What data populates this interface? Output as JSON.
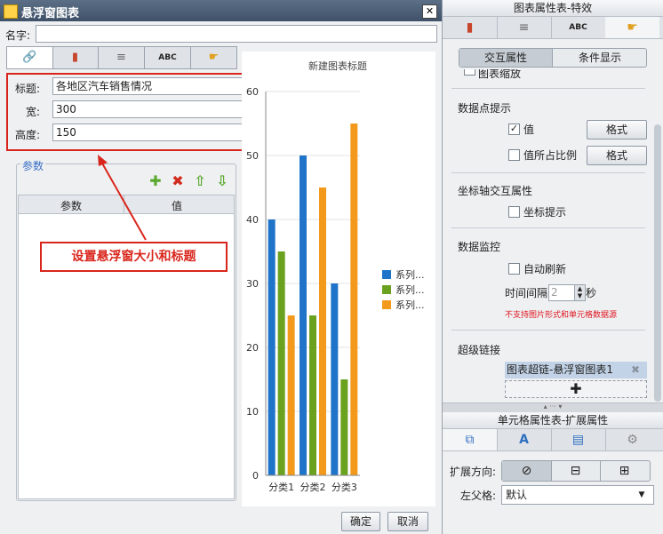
{
  "dialog": {
    "title": "悬浮窗图表",
    "close_glyph": "✕",
    "name_label": "名字:",
    "tabs": [
      {
        "icon": "link-icon",
        "glyph": "🔗"
      },
      {
        "icon": "chart-type-icon",
        "glyph": "▮"
      },
      {
        "icon": "database-icon",
        "glyph": "≡"
      },
      {
        "icon": "text-style-icon",
        "glyph": "ABC"
      },
      {
        "icon": "effect-icon",
        "glyph": "☛"
      }
    ],
    "fields": {
      "title_label": "标题:",
      "title_value": "各地区汽车销售情况",
      "width_label": "宽:",
      "width_value": "300",
      "height_label": "高度:",
      "height_value": "150"
    },
    "params": {
      "group_title": "参数",
      "tools": [
        {
          "icon": "add-icon",
          "glyph": "✚",
          "color": "#5aa82c"
        },
        {
          "icon": "delete-icon",
          "glyph": "✖",
          "color": "#d22a1e"
        },
        {
          "icon": "move-up-icon",
          "glyph": "⇧",
          "color": "#5aa82c"
        },
        {
          "icon": "move-down-icon",
          "glyph": "⇩",
          "color": "#5aa82c"
        }
      ],
      "col_param": "参数",
      "col_value": "值"
    },
    "annotation": "设置悬浮窗大小和标题",
    "ok_label": "确定",
    "cancel_label": "取消"
  },
  "chart_data": {
    "type": "bar",
    "title": "新建图表标题",
    "categories": [
      "分类1",
      "分类2",
      "分类3"
    ],
    "series": [
      {
        "name": "系列...",
        "values": [
          40,
          50,
          30
        ],
        "color": "#1f73c8"
      },
      {
        "name": "系列...",
        "values": [
          35,
          25,
          15
        ],
        "color": "#6aa11e"
      },
      {
        "name": "系列...",
        "values": [
          25,
          45,
          55
        ],
        "color": "#f39a1c"
      }
    ],
    "ylim": [
      0,
      60
    ],
    "yticks": [
      "0",
      "10",
      "20",
      "30",
      "40",
      "50",
      "60"
    ],
    "grid": true,
    "legend": "right"
  },
  "right_panel": {
    "top_title": "图表属性表-特效",
    "top_tabs": [
      {
        "icon": "chart-type-icon",
        "glyph": "▮"
      },
      {
        "icon": "database-icon",
        "glyph": "≡"
      },
      {
        "icon": "text-style-icon",
        "glyph": "ABC"
      },
      {
        "icon": "effect-icon",
        "glyph": "☛"
      }
    ],
    "seg_interact": "交互属性",
    "seg_condition": "条件显示",
    "cut_text": "图表缩放",
    "datapoint_title": "数据点提示",
    "value_label": "值",
    "value_checked": true,
    "percent_label": "值所占比例",
    "percent_checked": false,
    "format_label": "格式",
    "axis_title": "坐标轴交互属性",
    "axis_hint_label": "坐标提示",
    "monitor_title": "数据监控",
    "auto_refresh_label": "自动刷新",
    "interval_label": "时间间隔",
    "interval_value": "2",
    "seconds_label": "秒",
    "warning": "不支持图片形式和单元格数据源",
    "hyperlink_title": "超级链接",
    "hyperlink_item": "图表超链-悬浮窗图表1",
    "remove_glyph": "✖",
    "add_glyph": "✚",
    "bottom_title": "单元格属性表-扩展属性",
    "bottom_tabs": [
      {
        "icon": "cell-icon",
        "glyph": "⧉"
      },
      {
        "icon": "format-icon",
        "glyph": "A"
      },
      {
        "icon": "style-icon",
        "glyph": "▤"
      },
      {
        "icon": "settings-icon",
        "glyph": "⚙"
      }
    ],
    "expand_label": "扩展方向:",
    "dir_options": [
      {
        "icon": "no-expand-icon",
        "glyph": "⊘"
      },
      {
        "icon": "vertical-expand-icon",
        "glyph": "⊟"
      },
      {
        "icon": "horizontal-expand-icon",
        "glyph": "⊞"
      }
    ],
    "parent_label": "左父格:",
    "parent_value": "默认",
    "parent_arrow": "▼"
  }
}
